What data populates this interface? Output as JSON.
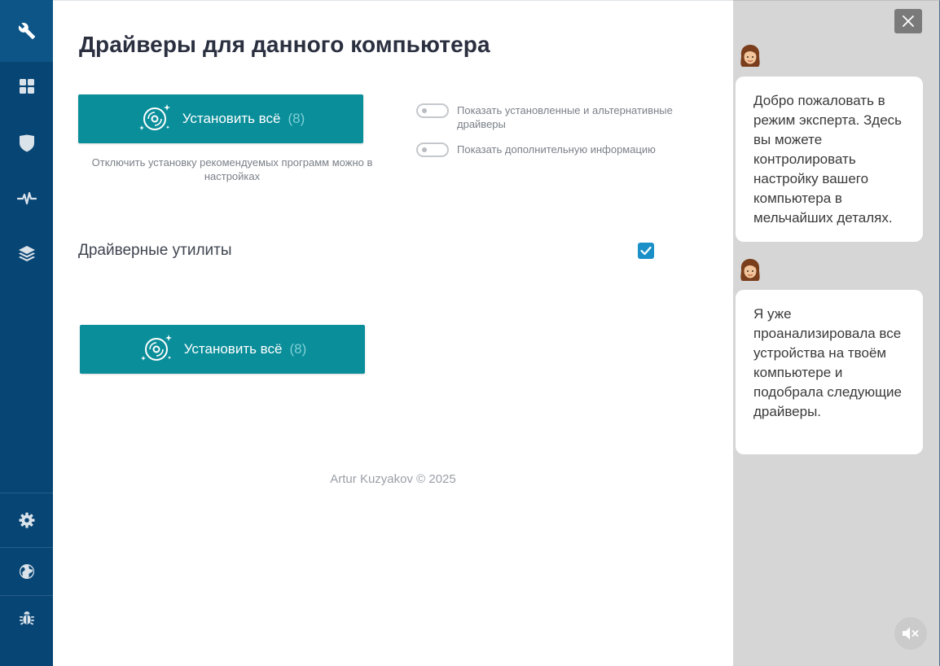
{
  "sidebar": {
    "items": [
      {
        "icon": "wrench-icon",
        "active": true
      },
      {
        "icon": "grid-icon",
        "active": false
      },
      {
        "icon": "shield-icon",
        "active": false
      },
      {
        "icon": "pulse-icon",
        "active": false
      },
      {
        "icon": "layers-icon",
        "active": false
      }
    ],
    "bottom_items": [
      {
        "icon": "gear-icon"
      },
      {
        "icon": "globe-icon"
      },
      {
        "icon": "bug-icon"
      }
    ]
  },
  "main": {
    "title": "Драйверы для данного компьютера",
    "install_button": {
      "label": "Установить всё",
      "count": "(8)",
      "icon": "disc-sparkle-icon"
    },
    "install_note": "Отключить установку рекомендуемых программ можно в настройках",
    "toggles": [
      {
        "label": "Показать установленные и альтернативные драйверы",
        "on": false
      },
      {
        "label": "Показать дополнительную информацию",
        "on": false
      }
    ],
    "utilities": {
      "title": "Драйверные утилиты",
      "checked": true
    },
    "install_button_bottom": {
      "label": "Установить всё",
      "count": "(8)",
      "icon": "disc-sparkle-icon"
    },
    "footer": "Artur Kuzyakov © 2025"
  },
  "assistant": {
    "messages": [
      {
        "avatar": "avatar-woman-icon",
        "text": "Добро пожаловать в режим эксперта. Здесь вы можете контролировать настройку вашего компьютера в мельчайших деталях."
      },
      {
        "avatar": "avatar-woman-icon",
        "text": "Я уже проанализировала все устройства на твоём компьютере и подобрала следующие драйверы."
      }
    ],
    "close_icon": "close-icon",
    "mute_icon": "speaker-mute-icon"
  },
  "colors": {
    "sidebar": "#074575",
    "sidebar_active": "#0d5586",
    "accent": "#0a8e9a",
    "checkbox": "#1a8fc8",
    "assistant_bg": "#d6d6d6"
  }
}
